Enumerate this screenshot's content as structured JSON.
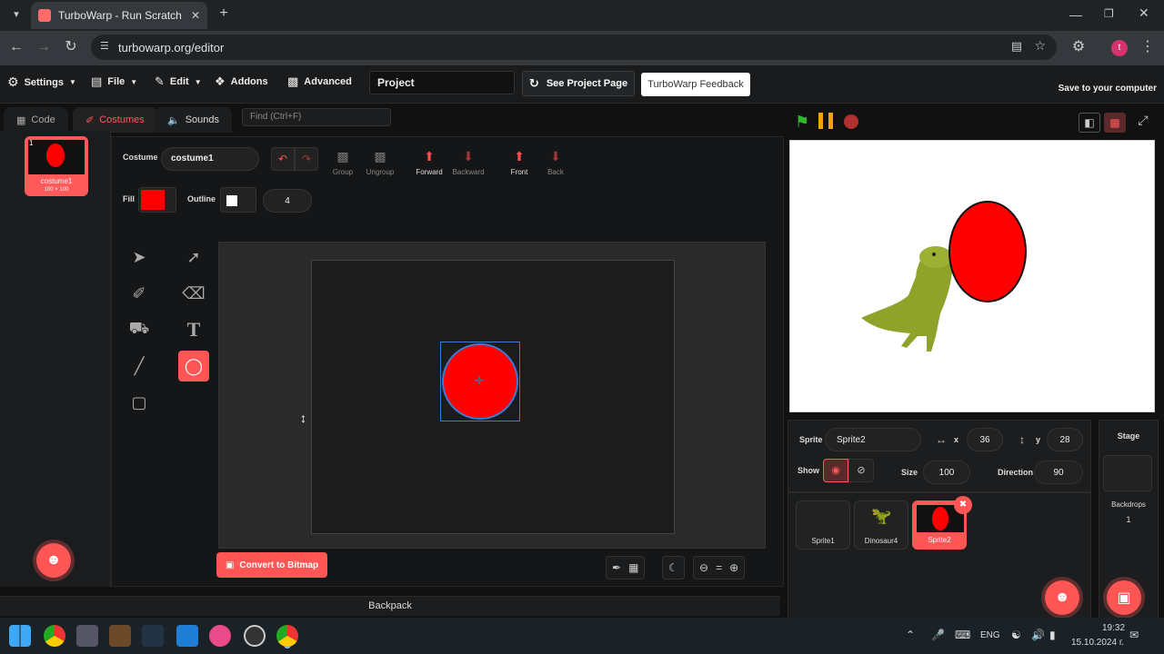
{
  "browser": {
    "tab_title": "TurboWarp - Run Scratch proje",
    "url": "turbowarp.org/editor",
    "avatar_letter": "t"
  },
  "menu": {
    "settings": "Settings",
    "file": "File",
    "edit": "Edit",
    "addons": "Addons",
    "advanced": "Advanced",
    "project_name": "Project",
    "see_project_page": "See Project Page",
    "feedback": "TurboWarp Feedback",
    "save": "Save to your computer"
  },
  "editor_tabs": {
    "code": "Code",
    "costumes": "Costumes",
    "sounds": "Sounds",
    "find_placeholder": "Find (Ctrl+F)"
  },
  "costume_list": [
    {
      "index": "1",
      "name": "costume1",
      "size": "100 × 100"
    }
  ],
  "paint": {
    "costume_label": "Costume",
    "costume_name": "costume1",
    "fill_label": "Fill",
    "outline_label": "Outline",
    "outline_width": "4",
    "fill_color": "#ff0000",
    "outline_color": "#ffffff",
    "buttons": {
      "group": "Group",
      "ungroup": "Ungroup",
      "forward": "Forward",
      "backward": "Backward",
      "front": "Front",
      "back": "Back"
    },
    "convert": "Convert to Bitmap"
  },
  "backpack": "Backpack",
  "sprite_info": {
    "sprite_label": "Sprite",
    "sprite_name": "Sprite2",
    "x_label": "x",
    "x": "36",
    "y_label": "y",
    "y": "28",
    "show_label": "Show",
    "size_label": "Size",
    "size": "100",
    "direction_label": "Direction",
    "direction": "90"
  },
  "sprites": [
    {
      "name": "Sprite1"
    },
    {
      "name": "Dinosaur4"
    },
    {
      "name": "Sprite2"
    }
  ],
  "stage_panel": {
    "title": "Stage",
    "backdrops_label": "Backdrops",
    "backdrops_count": "1"
  },
  "taskbar": {
    "lang": "ENG",
    "time": "19:32",
    "date": "15.10.2024 г."
  },
  "colors": {
    "accent": "#ff5555",
    "fill_red": "#ff0000",
    "dino_green": "#8fa32a"
  }
}
